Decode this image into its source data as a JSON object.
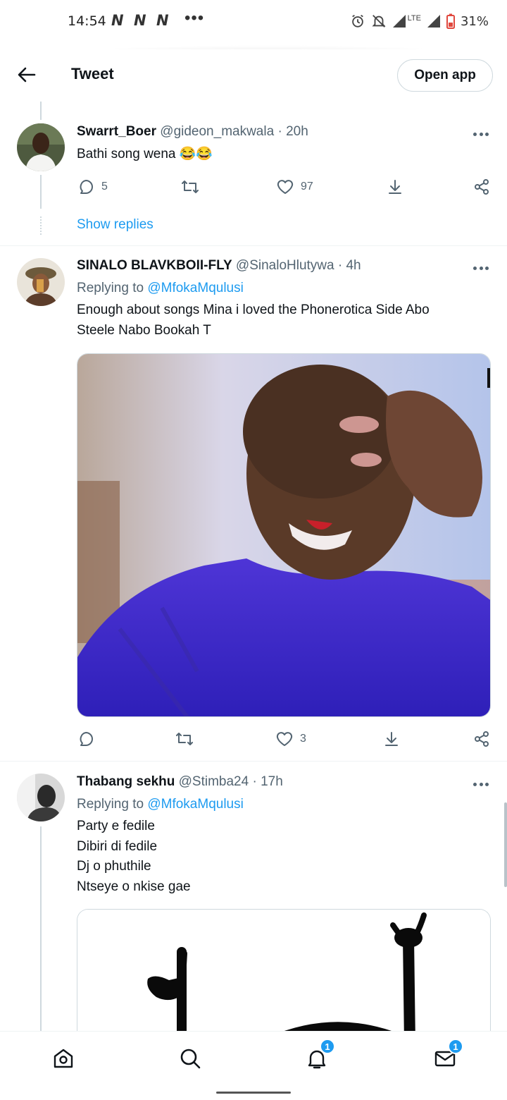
{
  "status_bar": {
    "time": "14:54",
    "n_icons": [
      "N",
      "N",
      "N"
    ],
    "more": "•••",
    "network": "LTE",
    "battery": "31%"
  },
  "header": {
    "title": "Tweet",
    "open_app": "Open app"
  },
  "tweets": [
    {
      "display_name": "Swarrt_Boer",
      "handle": "@gideon_makwala",
      "separator": "·",
      "time": "20h",
      "text": "Bathi song wena 😂😂",
      "replies": "5",
      "retweets": "",
      "likes": "97",
      "show_replies": "Show replies"
    },
    {
      "display_name": "SINALO BLAVKBOII-FLY",
      "handle": "@SinaloHlutywa",
      "separator": "·",
      "time": "4h",
      "replying_prefix": "Replying to",
      "replying_to": "@MfokaMqulusi",
      "text_lines": [
        "Enough about songs Mina i loved the Phonerotica Side Abo",
        "Steele Nabo Bookah T"
      ],
      "replies": "",
      "retweets": "",
      "likes": "3"
    },
    {
      "display_name": "Thabang sekhu",
      "handle": "@Stimba24",
      "separator": "·",
      "time": "17h",
      "replying_prefix": "Replying to",
      "replying_to": "@MfokaMqulusi",
      "text_lines": [
        "Party e fedile",
        "Dibiri di fedile",
        "Dj o phuthile",
        "Ntseye o nkise gae"
      ]
    }
  ],
  "bottom_nav": {
    "notifications_badge": "1",
    "messages_badge": "1"
  },
  "colors": {
    "accent": "#1d9bf0",
    "secondary_text": "#536471",
    "primary_text": "#0f1419",
    "border": "#cfd9de"
  },
  "icons": [
    "back-arrow-icon",
    "reply-icon",
    "retweet-icon",
    "like-icon",
    "download-icon",
    "share-icon",
    "more-icon",
    "home-icon",
    "search-icon",
    "bell-icon",
    "mail-icon"
  ]
}
